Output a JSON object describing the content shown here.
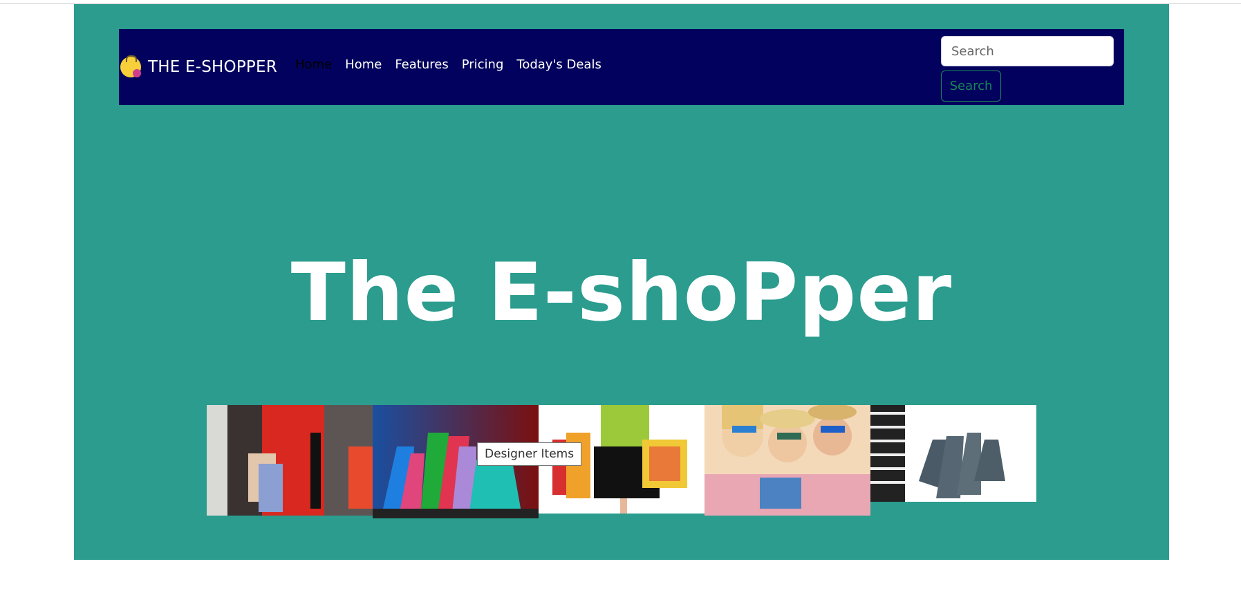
{
  "brand": {
    "name": "THE E-SHOPPER",
    "logo_icon": "shopping-bag-logo-icon"
  },
  "nav": {
    "items": [
      {
        "label": "Home",
        "active": true
      },
      {
        "label": "Home",
        "active": false
      },
      {
        "label": "Features",
        "active": false
      },
      {
        "label": "Pricing",
        "active": false
      },
      {
        "label": "Today's Deals",
        "active": false
      }
    ]
  },
  "search": {
    "placeholder": "Search",
    "button_label": "Search"
  },
  "hero": {
    "title": "The E-shoPper"
  },
  "gallery": {
    "images": [
      {
        "subject": "woman in red coat with shopping bags"
      },
      {
        "subject": "colorful shopping bags"
      },
      {
        "subject": "person holding shopping bags"
      },
      {
        "subject": "three women with sunglasses shopping"
      },
      {
        "subject": "woman holding grey shopping bags"
      }
    ],
    "tooltip": "Designer Items"
  },
  "colors": {
    "panel": "#2b9c8e",
    "navbar": "#02025e",
    "accent_green": "#198754"
  }
}
